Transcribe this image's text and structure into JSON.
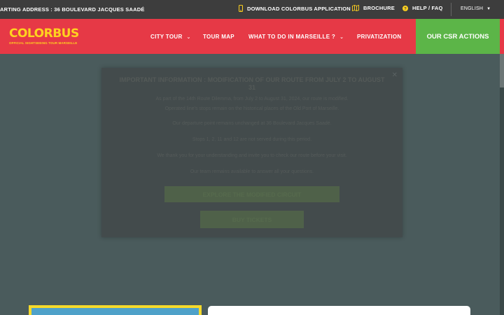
{
  "topbar": {
    "address": "ARTING ADDRESS : 36 BOULEVARD JACQUES SAADÉ",
    "download_app": "DOWNLOAD COLORBUS APPLICATION",
    "brochure": "BROCHURE",
    "help": "HELP / FAQ",
    "language": "ENGLISH",
    "icons": {
      "download": "mobile-phone-icon",
      "brochure": "map-icon",
      "help": "question-circle-icon",
      "language_caret": "caret-down-icon"
    }
  },
  "nav": {
    "logo_text": "COLORBUS",
    "logo_tagline": "OFFICIAL SIGHTSEEING TOUR MARSEILLE",
    "items": [
      {
        "label": "CITY TOUR",
        "dropdown": true
      },
      {
        "label": "TOUR MAP",
        "dropdown": false
      },
      {
        "label": "WHAT TO DO IN MARSEILLE ?",
        "dropdown": true
      },
      {
        "label": "PRIVATIZATION",
        "dropdown": false
      }
    ],
    "csr_button": "OUR CSR ACTIONS"
  },
  "modal": {
    "title": "IMPORTANT INFORMATION : MODIFICATION OF OUR ROUTE FROM JULY 2 TO AUGUST 31",
    "lines": [
      "As part of the 14th Route Dilemma, from July 2 to August 31, 2024, our route is modified.",
      "Operated line's stops remain on the historical places of the Old Port of Marseille.",
      "Our departure point remains unchanged at 36 Boulevard Jacques Saadé.",
      "Stops 1, 2, 11 and 12 are not served during this period.",
      "We thank you for your understanding and invite you to check our route before your visit.",
      "Our team remains available to answer all your questions."
    ],
    "button_primary": "EXPLORE THE MODIFIED CIRCUIT",
    "button_secondary": "BUY TICKETS",
    "close_icon": "close-icon"
  },
  "colors": {
    "nav_red": "#e63946",
    "brand_yellow": "#ffd21f",
    "csr_green": "#5cb548",
    "topbar_dark": "#3d3d3d",
    "overlay": "#4a5b5c"
  }
}
